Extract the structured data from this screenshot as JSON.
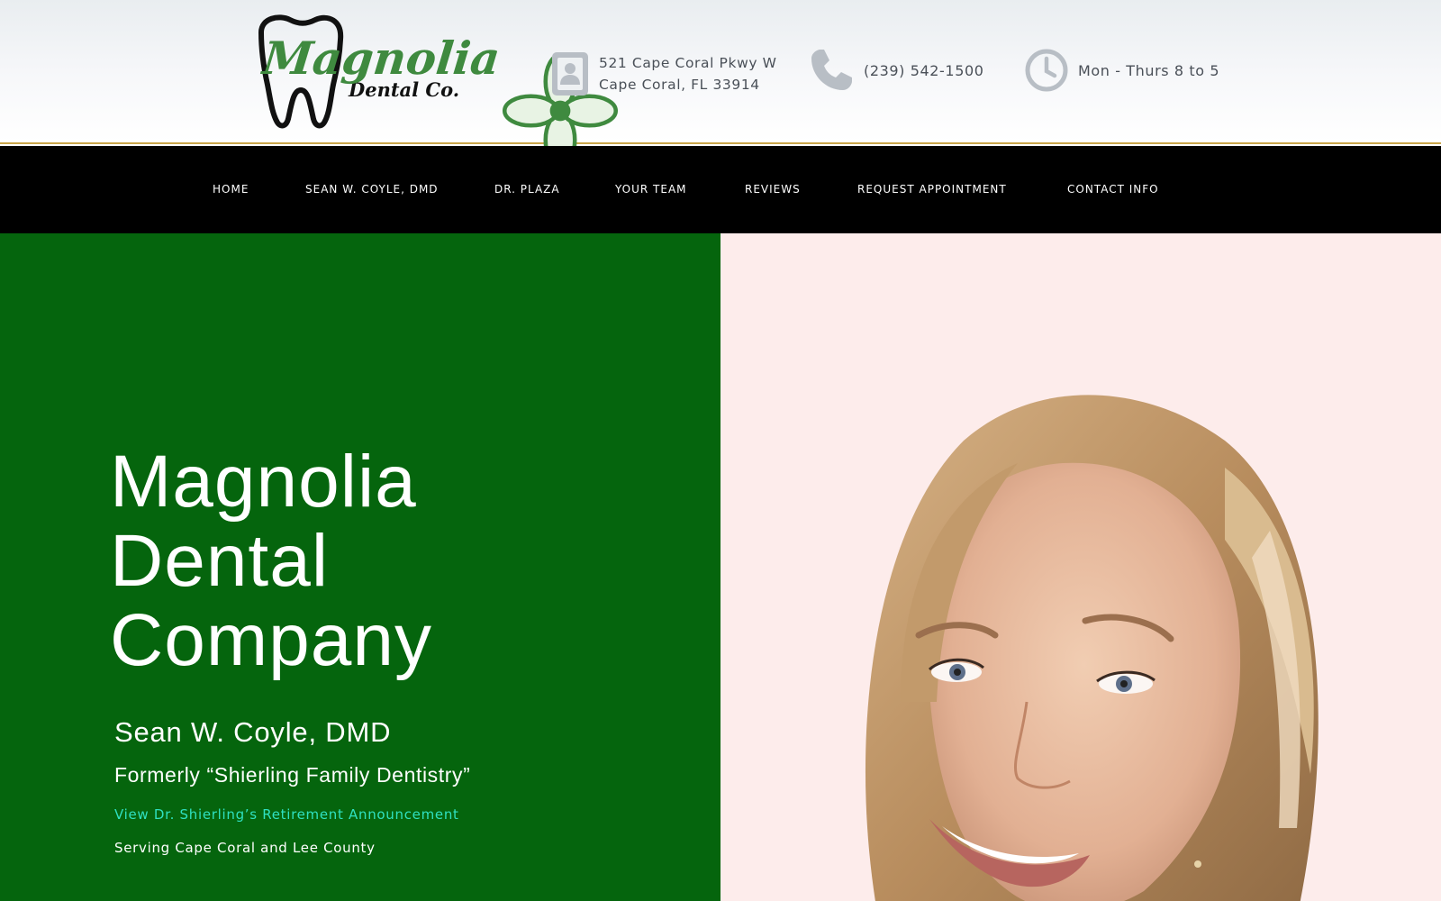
{
  "header": {
    "logo": {
      "word": "Magnolia",
      "sub": "Dental Co."
    },
    "address": {
      "line1": "521 Cape Coral Pkwy W",
      "line2": "Cape Coral, FL 33914",
      "icon": "address-book-icon"
    },
    "phone": {
      "text": "(239) 542-1500",
      "icon": "phone-icon"
    },
    "hours": {
      "text": "Mon - Thurs 8 to 5",
      "icon": "clock-icon"
    }
  },
  "nav": {
    "items": [
      "HOME",
      "SEAN W. COYLE, DMD",
      "DR. PLAZA",
      "YOUR TEAM",
      "REVIEWS",
      "REQUEST APPOINTMENT",
      "CONTACT INFO"
    ]
  },
  "hero": {
    "title_lines": [
      "Magnolia",
      "Dental",
      "Company"
    ],
    "doctor": "Sean W. Coyle, DMD",
    "formerly": "Formerly “Shierling Family Dentistry”",
    "announcement_link": "View Dr. Shierling’s Retirement Announcement",
    "serving": "Serving Cape Coral and Lee County"
  },
  "colors": {
    "hero_green": "#05650d",
    "link_teal": "#2fe0c0",
    "nav_bg": "#000000",
    "accent_gold": "#c9a54a",
    "photo_bg": "#fdeceb"
  }
}
